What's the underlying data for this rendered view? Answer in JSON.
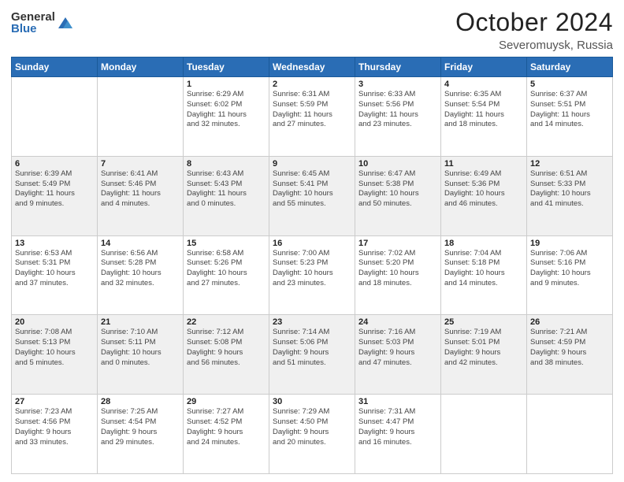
{
  "header": {
    "logo_general": "General",
    "logo_blue": "Blue",
    "month_title": "October 2024",
    "location": "Severomuysk, Russia"
  },
  "days_of_week": [
    "Sunday",
    "Monday",
    "Tuesday",
    "Wednesday",
    "Thursday",
    "Friday",
    "Saturday"
  ],
  "weeks": [
    [
      {
        "day": "",
        "sunrise": "",
        "sunset": "",
        "daylight": ""
      },
      {
        "day": "",
        "sunrise": "",
        "sunset": "",
        "daylight": ""
      },
      {
        "day": "1",
        "sunrise": "Sunrise: 6:29 AM",
        "sunset": "Sunset: 6:02 PM",
        "daylight": "Daylight: 11 hours and 32 minutes."
      },
      {
        "day": "2",
        "sunrise": "Sunrise: 6:31 AM",
        "sunset": "Sunset: 5:59 PM",
        "daylight": "Daylight: 11 hours and 27 minutes."
      },
      {
        "day": "3",
        "sunrise": "Sunrise: 6:33 AM",
        "sunset": "Sunset: 5:56 PM",
        "daylight": "Daylight: 11 hours and 23 minutes."
      },
      {
        "day": "4",
        "sunrise": "Sunrise: 6:35 AM",
        "sunset": "Sunset: 5:54 PM",
        "daylight": "Daylight: 11 hours and 18 minutes."
      },
      {
        "day": "5",
        "sunrise": "Sunrise: 6:37 AM",
        "sunset": "Sunset: 5:51 PM",
        "daylight": "Daylight: 11 hours and 14 minutes."
      }
    ],
    [
      {
        "day": "6",
        "sunrise": "Sunrise: 6:39 AM",
        "sunset": "Sunset: 5:49 PM",
        "daylight": "Daylight: 11 hours and 9 minutes."
      },
      {
        "day": "7",
        "sunrise": "Sunrise: 6:41 AM",
        "sunset": "Sunset: 5:46 PM",
        "daylight": "Daylight: 11 hours and 4 minutes."
      },
      {
        "day": "8",
        "sunrise": "Sunrise: 6:43 AM",
        "sunset": "Sunset: 5:43 PM",
        "daylight": "Daylight: 11 hours and 0 minutes."
      },
      {
        "day": "9",
        "sunrise": "Sunrise: 6:45 AM",
        "sunset": "Sunset: 5:41 PM",
        "daylight": "Daylight: 10 hours and 55 minutes."
      },
      {
        "day": "10",
        "sunrise": "Sunrise: 6:47 AM",
        "sunset": "Sunset: 5:38 PM",
        "daylight": "Daylight: 10 hours and 50 minutes."
      },
      {
        "day": "11",
        "sunrise": "Sunrise: 6:49 AM",
        "sunset": "Sunset: 5:36 PM",
        "daylight": "Daylight: 10 hours and 46 minutes."
      },
      {
        "day": "12",
        "sunrise": "Sunrise: 6:51 AM",
        "sunset": "Sunset: 5:33 PM",
        "daylight": "Daylight: 10 hours and 41 minutes."
      }
    ],
    [
      {
        "day": "13",
        "sunrise": "Sunrise: 6:53 AM",
        "sunset": "Sunset: 5:31 PM",
        "daylight": "Daylight: 10 hours and 37 minutes."
      },
      {
        "day": "14",
        "sunrise": "Sunrise: 6:56 AM",
        "sunset": "Sunset: 5:28 PM",
        "daylight": "Daylight: 10 hours and 32 minutes."
      },
      {
        "day": "15",
        "sunrise": "Sunrise: 6:58 AM",
        "sunset": "Sunset: 5:26 PM",
        "daylight": "Daylight: 10 hours and 27 minutes."
      },
      {
        "day": "16",
        "sunrise": "Sunrise: 7:00 AM",
        "sunset": "Sunset: 5:23 PM",
        "daylight": "Daylight: 10 hours and 23 minutes."
      },
      {
        "day": "17",
        "sunrise": "Sunrise: 7:02 AM",
        "sunset": "Sunset: 5:20 PM",
        "daylight": "Daylight: 10 hours and 18 minutes."
      },
      {
        "day": "18",
        "sunrise": "Sunrise: 7:04 AM",
        "sunset": "Sunset: 5:18 PM",
        "daylight": "Daylight: 10 hours and 14 minutes."
      },
      {
        "day": "19",
        "sunrise": "Sunrise: 7:06 AM",
        "sunset": "Sunset: 5:16 PM",
        "daylight": "Daylight: 10 hours and 9 minutes."
      }
    ],
    [
      {
        "day": "20",
        "sunrise": "Sunrise: 7:08 AM",
        "sunset": "Sunset: 5:13 PM",
        "daylight": "Daylight: 10 hours and 5 minutes."
      },
      {
        "day": "21",
        "sunrise": "Sunrise: 7:10 AM",
        "sunset": "Sunset: 5:11 PM",
        "daylight": "Daylight: 10 hours and 0 minutes."
      },
      {
        "day": "22",
        "sunrise": "Sunrise: 7:12 AM",
        "sunset": "Sunset: 5:08 PM",
        "daylight": "Daylight: 9 hours and 56 minutes."
      },
      {
        "day": "23",
        "sunrise": "Sunrise: 7:14 AM",
        "sunset": "Sunset: 5:06 PM",
        "daylight": "Daylight: 9 hours and 51 minutes."
      },
      {
        "day": "24",
        "sunrise": "Sunrise: 7:16 AM",
        "sunset": "Sunset: 5:03 PM",
        "daylight": "Daylight: 9 hours and 47 minutes."
      },
      {
        "day": "25",
        "sunrise": "Sunrise: 7:19 AM",
        "sunset": "Sunset: 5:01 PM",
        "daylight": "Daylight: 9 hours and 42 minutes."
      },
      {
        "day": "26",
        "sunrise": "Sunrise: 7:21 AM",
        "sunset": "Sunset: 4:59 PM",
        "daylight": "Daylight: 9 hours and 38 minutes."
      }
    ],
    [
      {
        "day": "27",
        "sunrise": "Sunrise: 7:23 AM",
        "sunset": "Sunset: 4:56 PM",
        "daylight": "Daylight: 9 hours and 33 minutes."
      },
      {
        "day": "28",
        "sunrise": "Sunrise: 7:25 AM",
        "sunset": "Sunset: 4:54 PM",
        "daylight": "Daylight: 9 hours and 29 minutes."
      },
      {
        "day": "29",
        "sunrise": "Sunrise: 7:27 AM",
        "sunset": "Sunset: 4:52 PM",
        "daylight": "Daylight: 9 hours and 24 minutes."
      },
      {
        "day": "30",
        "sunrise": "Sunrise: 7:29 AM",
        "sunset": "Sunset: 4:50 PM",
        "daylight": "Daylight: 9 hours and 20 minutes."
      },
      {
        "day": "31",
        "sunrise": "Sunrise: 7:31 AM",
        "sunset": "Sunset: 4:47 PM",
        "daylight": "Daylight: 9 hours and 16 minutes."
      },
      {
        "day": "",
        "sunrise": "",
        "sunset": "",
        "daylight": ""
      },
      {
        "day": "",
        "sunrise": "",
        "sunset": "",
        "daylight": ""
      }
    ]
  ]
}
